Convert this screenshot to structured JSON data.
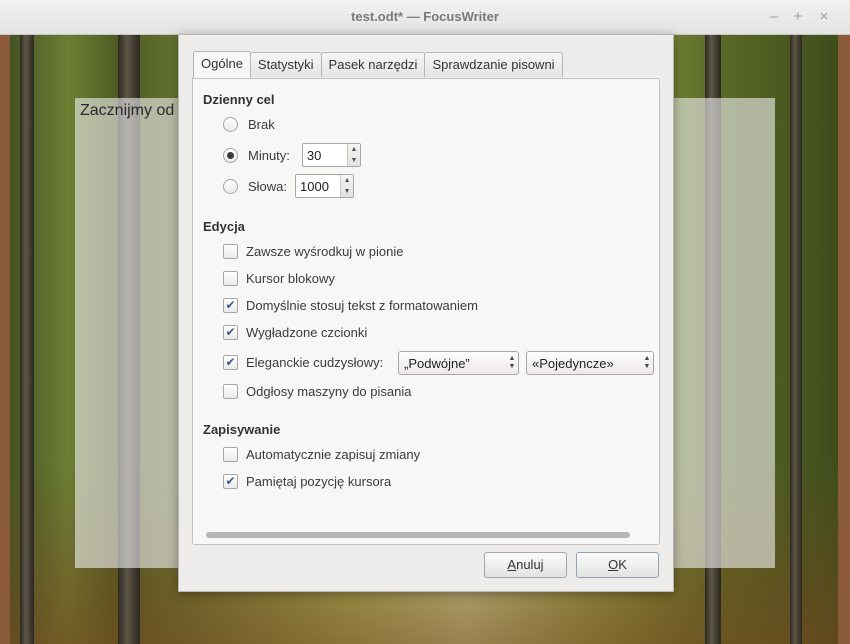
{
  "window": {
    "title": "test.odt* — FocusWriter",
    "controls": [
      "minimize-icon",
      "maximize-icon",
      "close-icon"
    ]
  },
  "editor": {
    "text": "Zacznijmy od"
  },
  "dialog": {
    "tabs": [
      {
        "label": "Ogólne",
        "active": true
      },
      {
        "label": "Statystyki",
        "active": false
      },
      {
        "label": "Pasek narzędzi",
        "active": false
      },
      {
        "label": "Sprawdzanie pisowni",
        "active": false
      }
    ],
    "daily_goal": {
      "heading": "Dzienny cel",
      "options": [
        {
          "label": "Brak",
          "selected": false
        },
        {
          "label": "Minuty:",
          "selected": true,
          "value": "30"
        },
        {
          "label": "Słowa:",
          "selected": false,
          "value": "1000"
        }
      ]
    },
    "editing": {
      "heading": "Edycja",
      "options": [
        {
          "label": "Zawsze wyśrodkuj w pionie",
          "checked": false
        },
        {
          "label": "Kursor blokowy",
          "checked": false
        },
        {
          "label": "Domyślnie stosuj tekst z formatowaniem",
          "checked": true
        },
        {
          "label": "Wygładzone czcionki",
          "checked": true
        },
        {
          "label": "Eleganckie cudzysłowy:",
          "checked": true
        },
        {
          "label": "Odgłosy maszyny do pisania",
          "checked": false
        }
      ],
      "double_quotes": "„Podwójne”",
      "single_quotes": "«Pojedyncze»"
    },
    "saving": {
      "heading": "Zapisywanie",
      "options": [
        {
          "label": "Automatycznie zapisuj zmiany",
          "checked": false
        },
        {
          "label": "Pamiętaj pozycję kursora",
          "checked": true
        }
      ]
    },
    "buttons": {
      "cancel_prefix": "",
      "cancel_mnemonic": "A",
      "cancel_rest": "nuluj",
      "ok_mnemonic": "O",
      "ok_rest": "K"
    }
  },
  "colors": {
    "dialog_bg": "#edecea",
    "accent_check": "#3a5a8a"
  }
}
